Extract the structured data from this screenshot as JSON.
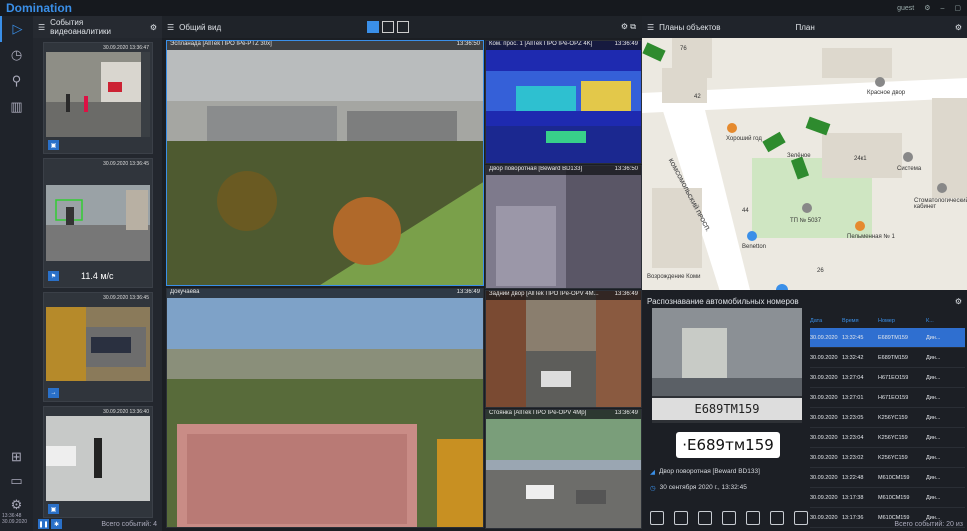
{
  "app": {
    "title": "Domination",
    "user": "guest"
  },
  "rail": {
    "icons": [
      "play-icon",
      "history-icon",
      "search-icon",
      "chart-icon",
      "layout-icon",
      "notification-icon",
      "settings-icon"
    ],
    "clock_time": "13:36:48",
    "clock_date": "30.09.2020"
  },
  "events": {
    "title": "События видеоаналитики",
    "cards": [
      {
        "time": "30.09.2020 13:36:47",
        "label": ""
      },
      {
        "time": "30.09.2020 13:36:45",
        "label": "11.4 м/с"
      },
      {
        "time": "30.09.2020 13:36:45",
        "label": ""
      },
      {
        "time": "30.09.2020 13:36:40",
        "label": ""
      }
    ],
    "footer": "Всего событий: 4"
  },
  "view": {
    "title": "Общий вид",
    "cams": [
      {
        "name": "Эспланада [AllTek ПРО IPe-PTZ 30x]",
        "time": "13:36:50"
      },
      {
        "name": "Ком. прос. 1 [AllTek ПРО IPe-OPZ 4K]",
        "time": "13:36:49"
      },
      {
        "name": "Двор поворотная [Beward BD133]",
        "time": "13:36:50"
      },
      {
        "name": "Докучаева",
        "time": "13:36:49"
      },
      {
        "name": "Задний двор [AllTek ПРО IPe-OPV 4M...",
        "time": "13:36:49"
      },
      {
        "name": "Стоянка [AllTek ПРО IPe-OPV 4Mp]",
        "time": "13:36:49"
      }
    ]
  },
  "map": {
    "title": "Планы объектов",
    "plan": "План",
    "labels": [
      "76",
      "42",
      "Красное двор",
      "Хороший год",
      "Зелёное",
      "24к1",
      "Система",
      "44",
      "Benetton",
      "ТП № 5037",
      "Пельменная № 1",
      "Стоматологический кабинет",
      "Возрождение Коми",
      "26"
    ],
    "street": "КОМСОМОЛЬСКИЙ ПРОСП."
  },
  "lpr": {
    "title": "Распознавание автомобильных номеров",
    "plate": "E689TM159",
    "plate_display": "·E689тм159",
    "camera": "Двор поворотная [Beward BD133]",
    "datetime": "30 сентября 2020 г., 13:32:45",
    "columns": [
      "Дата",
      "Время",
      "Номер",
      "К..."
    ],
    "rows": [
      {
        "date": "30.09.2020",
        "time": "13:32:45",
        "plate": "E689TM159",
        "type": "Дин..."
      },
      {
        "date": "30.09.2020",
        "time": "13:32:42",
        "plate": "E689TM159",
        "type": "Дин..."
      },
      {
        "date": "30.09.2020",
        "time": "13:27:04",
        "plate": "H671EO159",
        "type": "Дин..."
      },
      {
        "date": "30.09.2020",
        "time": "13:27:01",
        "plate": "H671EO159",
        "type": "Дин..."
      },
      {
        "date": "30.09.2020",
        "time": "13:23:05",
        "plate": "K256YC159",
        "type": "Дин..."
      },
      {
        "date": "30.09.2020",
        "time": "13:23:04",
        "plate": "K256YC159",
        "type": "Дин..."
      },
      {
        "date": "30.09.2020",
        "time": "13:23:02",
        "plate": "K256YC159",
        "type": "Дин..."
      },
      {
        "date": "30.09.2020",
        "time": "13:22:48",
        "plate": "M610CM159",
        "type": "Дин..."
      },
      {
        "date": "30.09.2020",
        "time": "13:17:38",
        "plate": "M610CM159",
        "type": "Дин..."
      },
      {
        "date": "30.09.2020",
        "time": "13:17:36",
        "plate": "M610CM159",
        "type": "Дин..."
      }
    ],
    "footer": "Всего событий: 20 из"
  },
  "colors": {
    "accent": "#3a8fe8",
    "panel": "#23272e",
    "selected_row": "#2f6fd0"
  }
}
